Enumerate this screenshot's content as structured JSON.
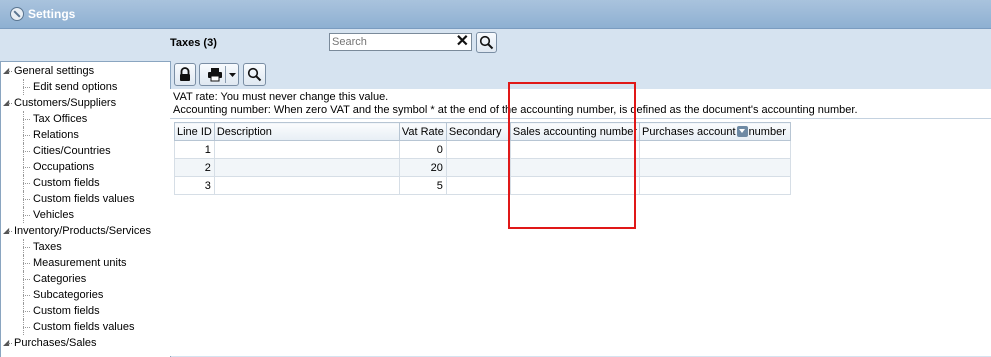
{
  "window": {
    "title": "Settings"
  },
  "tree": {
    "items": [
      {
        "label": "General settings",
        "level": 0
      },
      {
        "label": "Edit send options",
        "level": 1
      },
      {
        "label": "Customers/Suppliers",
        "level": 0
      },
      {
        "label": "Tax Offices",
        "level": 1
      },
      {
        "label": "Relations",
        "level": 1
      },
      {
        "label": "Cities/Countries",
        "level": 1
      },
      {
        "label": "Occupations",
        "level": 1
      },
      {
        "label": "Custom fields",
        "level": 1
      },
      {
        "label": "Custom fields values",
        "level": 1
      },
      {
        "label": "Vehicles",
        "level": 1
      },
      {
        "label": "Inventory/Products/Services",
        "level": 0
      },
      {
        "label": "Taxes",
        "level": 1
      },
      {
        "label": "Measurement units",
        "level": 1
      },
      {
        "label": "Categories",
        "level": 1
      },
      {
        "label": "Subcategories",
        "level": 1
      },
      {
        "label": "Custom fields",
        "level": 1
      },
      {
        "label": "Custom fields values",
        "level": 1
      },
      {
        "label": "Purchases/Sales",
        "level": 0
      }
    ]
  },
  "header": {
    "title": "Taxes (3)"
  },
  "search": {
    "placeholder": "Search",
    "value": "",
    "clear_symbol": "✕"
  },
  "info": {
    "line1": "VAT rate: You must never change this value.",
    "line2": "Accounting number: When zero VAT and the symbol * at the end of the accounting number, is defined as the document's accounting number."
  },
  "table": {
    "columns": [
      "Line ID",
      "Description",
      "Vat Rate",
      "Secondary",
      "Sales accounting number"
    ],
    "purchases_col": {
      "prefix": "Purchases account",
      "suffix": "number"
    },
    "rows": [
      {
        "line_id": "1",
        "description": "",
        "vat_rate": "0",
        "secondary": "",
        "sales_acc": "",
        "purchases_acc": ""
      },
      {
        "line_id": "2",
        "description": "",
        "vat_rate": "20",
        "secondary": "",
        "sales_acc": "",
        "purchases_acc": ""
      },
      {
        "line_id": "3",
        "description": "",
        "vat_rate": "5",
        "secondary": "",
        "sales_acc": "",
        "purchases_acc": ""
      }
    ]
  },
  "colors": {
    "highlight": "#e01818",
    "titlebar": "#8eb0d2",
    "background": "#d6e3f0"
  },
  "icons": [
    "settings-icon",
    "lock-icon",
    "print-icon",
    "dropdown-arrow-icon",
    "search-icon",
    "clear-icon",
    "column-menu-icon"
  ]
}
